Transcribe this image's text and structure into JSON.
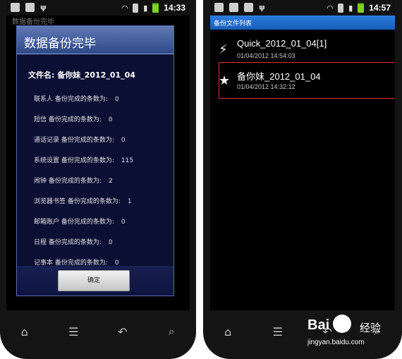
{
  "left_phone": {
    "status_time": "14:33",
    "background_title": "数据备份完毕",
    "dialog": {
      "title": "数据备份完毕",
      "file_name": "文件名: 备你妹_2012_01_04",
      "stats": [
        {
          "label": "联系人 备份完成的条数为:",
          "count": "0"
        },
        {
          "label": "短信 备份完成的条数为:",
          "count": "0"
        },
        {
          "label": "通话记录 备份完成的条数为:",
          "count": "0"
        },
        {
          "label": "系统设置 备份完成的条数为:",
          "count": "115"
        },
        {
          "label": "闹钟 备份完成的条数为:",
          "count": "2"
        },
        {
          "label": "浏览器书签 备份完成的条数为:",
          "count": "1"
        },
        {
          "label": "邮箱账户 备份完成的条数为:",
          "count": "0"
        },
        {
          "label": "日程 备份完成的条数为:",
          "count": "0"
        },
        {
          "label": "记事本 备份完成的条数为:",
          "count": "0"
        }
      ],
      "ok_label": "确定"
    },
    "softkeys": [
      "⌂",
      "☰",
      "↶",
      "⌕"
    ]
  },
  "right_phone": {
    "status_time": "14:57",
    "header": "备份文件列表",
    "files": [
      {
        "icon": "lightning-icon",
        "glyph": "⚡",
        "name": "Quick_2012_01_04[1]",
        "time": "01/04/2012 14:54:03"
      },
      {
        "icon": "star-icon",
        "glyph": "★",
        "name": "备你妹_2012_01_04",
        "time": "01/04/2012 14:32:12"
      }
    ],
    "softkeys": [
      "⌂",
      "☰",
      "↶",
      "⌕"
    ]
  },
  "watermark": {
    "brand": "Bai  u",
    "cn": "经验",
    "url": "jingyan.baidu.com"
  },
  "colors": {
    "accent_blue": "#2f7de0",
    "highlight_red": "#d8322d",
    "dialog_bg": "#0b0f33"
  }
}
